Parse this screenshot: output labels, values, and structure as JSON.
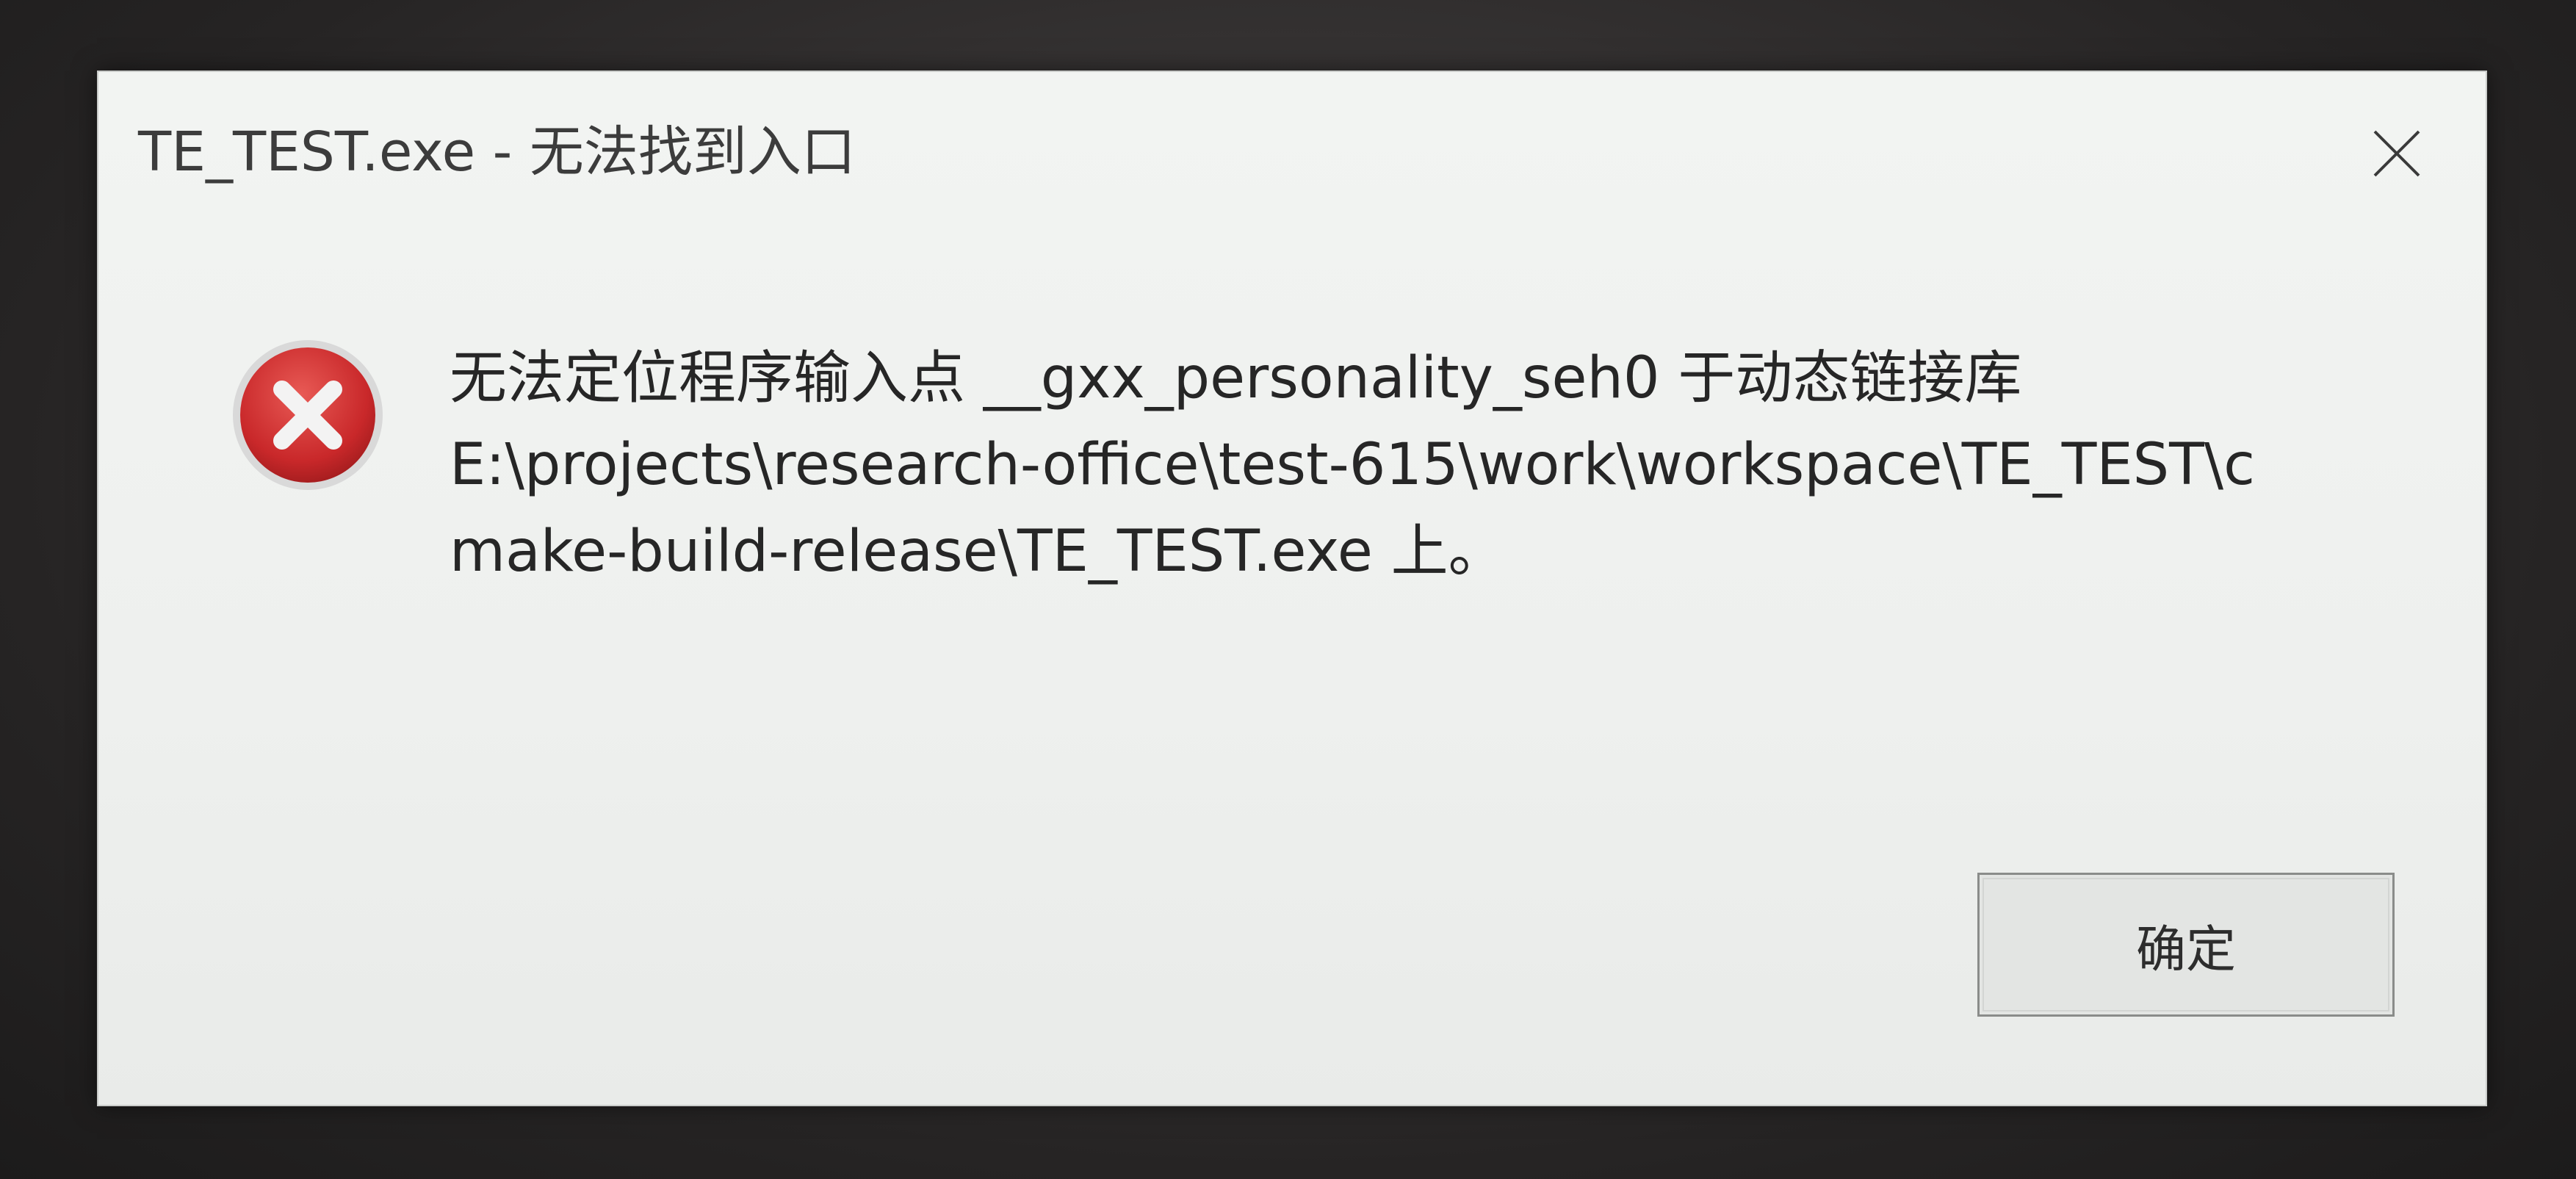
{
  "dialog": {
    "title": "TE_TEST.exe - 无法找到入口",
    "message_lines": [
      "无法定位程序输入点 __gxx_personality_seh0 于动态链接库",
      "E:\\projects\\research-office\\test-615\\work\\workspace\\TE_TEST\\c",
      "make-build-release\\TE_TEST.exe 上。"
    ],
    "ok_label": "确定",
    "close_icon": "close-icon",
    "error_icon": "error-icon",
    "colors": {
      "background": "#eef0ee",
      "error_red": "#c9282a",
      "text": "#262626"
    }
  }
}
